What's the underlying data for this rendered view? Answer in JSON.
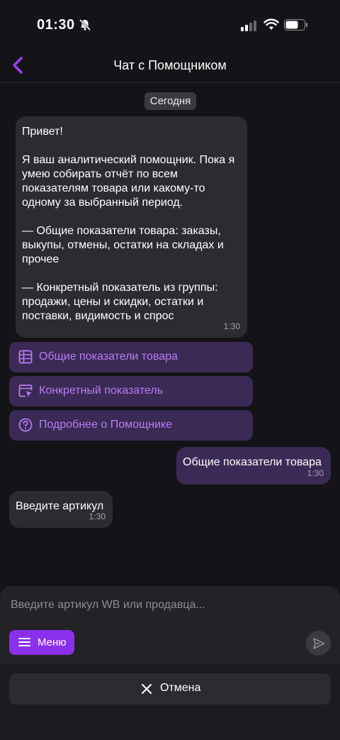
{
  "status": {
    "time": "01:30"
  },
  "header": {
    "title": "Чат с Помощником"
  },
  "chat": {
    "date_label": "Сегодня",
    "greeting": {
      "text": "Привет!\n\nЯ ваш аналитический помощник. Пока я умею собирать отчёт по всем показателям товара или какому-то одному за выбранный период.\n\n— Общие показатели товара: заказы, выкупы, отмены, остатки на складах и прочее\n\n— Конкретный показатель из группы: продажи, цены и скидки, остатки и поставки, видимость и спрос",
      "time": "1:30"
    },
    "actions": [
      {
        "label": "Общие показатели товара",
        "icon": "table-icon"
      },
      {
        "label": "Конкретный показатель",
        "icon": "cursor-select-icon"
      },
      {
        "label": "Подробнее о Помощнике",
        "icon": "help-circle-icon"
      }
    ],
    "user_message": {
      "text": "Общие показатели товара",
      "time": "1:30"
    },
    "bot_reply": {
      "text": "Введите артикул",
      "time": "1:30"
    }
  },
  "composer": {
    "placeholder": "Введите артикул WB или продавца...",
    "value": "",
    "menu_label": "Меню"
  },
  "footer": {
    "cancel_label": "Отмена"
  },
  "colors": {
    "accent": "#8a30ec",
    "accent_text": "#b77cf3",
    "action_bg": "#3b2a55",
    "bubble_bg": "#2c2b31",
    "page_bg": "#141317"
  }
}
